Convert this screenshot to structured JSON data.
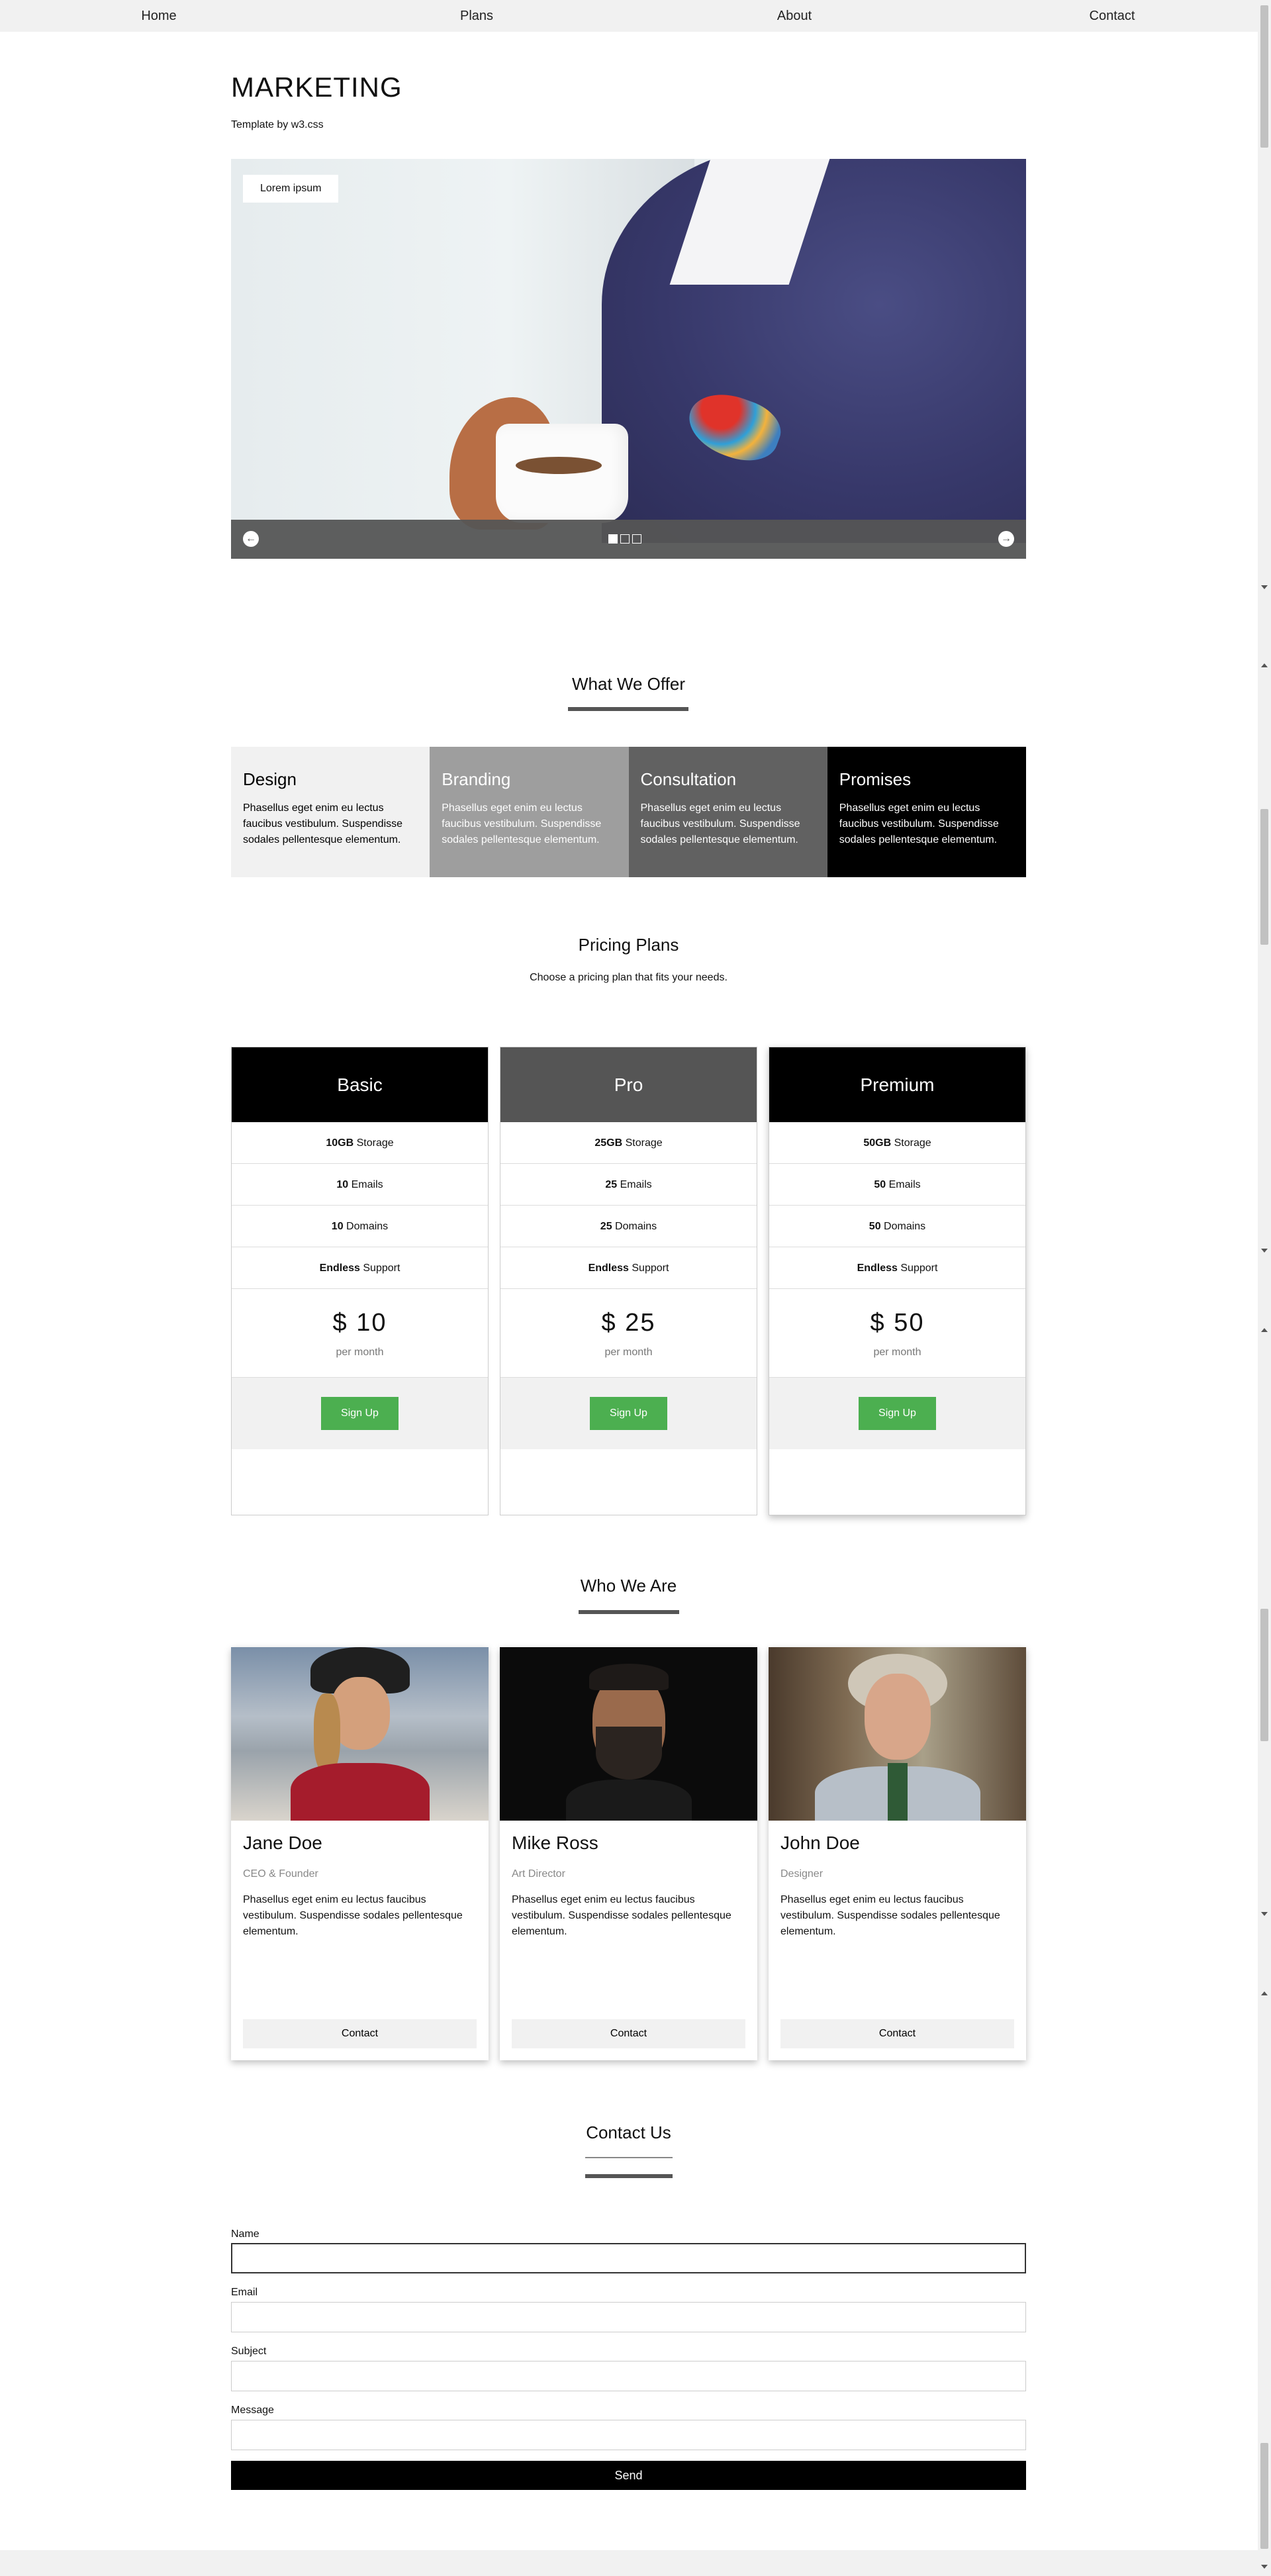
{
  "nav": {
    "home": "Home",
    "plans": "Plans",
    "about": "About",
    "contact": "Contact"
  },
  "header": {
    "title": "MARKETING",
    "subtitle": "Template by w3.css"
  },
  "hero": {
    "badge": "Lorem ipsum",
    "slides_total": 3,
    "active_slide": 1
  },
  "offer": {
    "title": "What We Offer",
    "items": [
      {
        "title": "Design",
        "text": "Phasellus eget enim eu lectus faucibus vestibulum. Suspendisse sodales pellentesque elementum.",
        "bg": "#f1f1f1",
        "fg": "#000000"
      },
      {
        "title": "Branding",
        "text": "Phasellus eget enim eu lectus faucibus vestibulum. Suspendisse sodales pellentesque elementum.",
        "bg": "#9e9e9e",
        "fg": "#ffffff"
      },
      {
        "title": "Consultation",
        "text": "Phasellus eget enim eu lectus faucibus vestibulum. Suspendisse sodales pellentesque elementum.",
        "bg": "#616161",
        "fg": "#ffffff"
      },
      {
        "title": "Promises",
        "text": "Phasellus eget enim eu lectus faucibus vestibulum. Suspendisse sodales pellentesque elementum.",
        "bg": "#000000",
        "fg": "#ffffff"
      }
    ]
  },
  "plans": {
    "title": "Pricing Plans",
    "subtitle": "Choose a pricing plan that fits your needs.",
    "items": [
      {
        "name": "Basic",
        "head_bg": "#000000",
        "storage": "10GB",
        "storage_label": "Storage",
        "emails": "10",
        "emails_label": "Emails",
        "domains": "10",
        "domains_label": "Domains",
        "support": "Endless",
        "support_label": "Support",
        "price": "$ 10",
        "period": "per month",
        "button": "Sign Up"
      },
      {
        "name": "Pro",
        "head_bg": "#555555",
        "storage": "25GB",
        "storage_label": "Storage",
        "emails": "25",
        "emails_label": "Emails",
        "domains": "25",
        "domains_label": "Domains",
        "support": "Endless",
        "support_label": "Support",
        "price": "$ 25",
        "period": "per month",
        "button": "Sign Up"
      },
      {
        "name": "Premium",
        "head_bg": "#000000",
        "storage": "50GB",
        "storage_label": "Storage",
        "emails": "50",
        "emails_label": "Emails",
        "domains": "50",
        "domains_label": "Domains",
        "support": "Endless",
        "support_label": "Support",
        "price": "$ 50",
        "period": "per month",
        "button": "Sign Up"
      }
    ]
  },
  "team": {
    "title": "Who We Are",
    "members": [
      {
        "name": "Jane Doe",
        "role": "CEO & Founder",
        "text": "Phasellus eget enim eu lectus faucibus vestibulum. Suspendisse sodales pellentesque elementum.",
        "button": "Contact"
      },
      {
        "name": "Mike Ross",
        "role": "Art Director",
        "text": "Phasellus eget enim eu lectus faucibus vestibulum. Suspendisse sodales pellentesque elementum.",
        "button": "Contact"
      },
      {
        "name": "John Doe",
        "role": "Designer",
        "text": "Phasellus eget enim eu lectus faucibus vestibulum. Suspendisse sodales pellentesque elementum.",
        "button": "Contact"
      }
    ]
  },
  "contact": {
    "title": "Contact Us",
    "name_label": "Name",
    "name_value": "",
    "email_label": "Email",
    "email_value": "",
    "subject_label": "Subject",
    "subject_value": "",
    "message_label": "Message",
    "message_value": "",
    "send": "Send"
  },
  "colors": {
    "accent_green": "#4caf50",
    "dark_gray": "#555555",
    "light_gray": "#f1f1f1"
  }
}
